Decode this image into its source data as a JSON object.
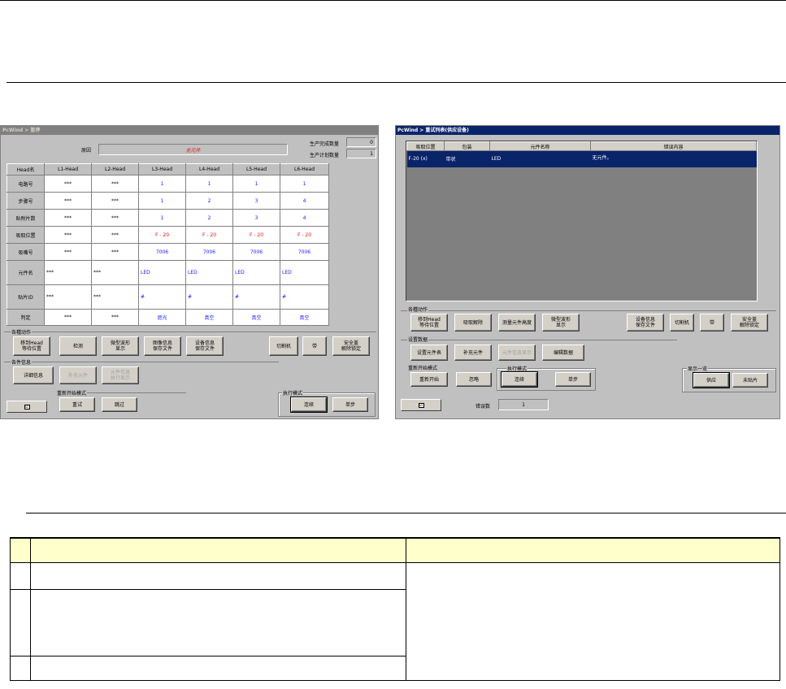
{
  "left_window": {
    "title": "PcWind > 暂停",
    "reason_label": "原因",
    "reason_value": "无元件",
    "production_done_label": "生产完成数量",
    "production_done_value": "0",
    "production_plan_label": "生产计划数量",
    "production_plan_value": "1",
    "grid_headers": [
      "Head名",
      "L1-Head",
      "L2-Head",
      "L3-Head",
      "L4-Head",
      "L5-Head",
      "L6-Head"
    ],
    "grid_rows": [
      {
        "label": "电路号",
        "cells": [
          "***",
          "***",
          "1",
          "1",
          "1",
          "1"
        ]
      },
      {
        "label": "步骤号",
        "cells": [
          "***",
          "***",
          "1",
          "2",
          "3",
          "4"
        ]
      },
      {
        "label": "贴附片数",
        "cells": [
          "***",
          "***",
          "1",
          "2",
          "3",
          "4"
        ]
      },
      {
        "label": "吸取位置",
        "cells": [
          "***",
          "***",
          "F - 20",
          "F - 20",
          "F - 20",
          "F - 20"
        ]
      },
      {
        "label": "吸嘴号",
        "cells": [
          "***",
          "***",
          "7006",
          "7006",
          "7006",
          "7006"
        ]
      },
      {
        "label": "元件名",
        "cells": [
          "***",
          "***",
          "LED",
          "LED",
          "LED",
          "LED"
        ]
      },
      {
        "label": "贴片ID",
        "cells": [
          "***",
          "***",
          "#",
          "#",
          "#",
          "#"
        ]
      },
      {
        "label": "判定",
        "cells": [
          "***",
          "***",
          "遮光",
          "真空",
          "真空",
          "真空"
        ]
      }
    ],
    "group_actions_label": "各種动作",
    "group_parts_label": "各件信息",
    "restart_mode_label": "重新开始模式",
    "exec_mode_label": "执行模式",
    "btn_move_head": "移到Head\n等待位置",
    "btn_detect": "检测",
    "btn_waveform": "微型波形\n显示",
    "btn_save_image": "图像信息\n保存文件",
    "btn_save_device": "设备信息\n保存文件",
    "btn_cutter": "切割机",
    "btn_tape": "带",
    "btn_safety": "安全盖\n解除锁定",
    "btn_detail": "详细信息",
    "btn_supply": "补充元件",
    "btn_parts_manage": "元件信息\n执行显示",
    "btn_retry": "重试",
    "btn_skip": "跳过",
    "btn_continuous": "连续",
    "btn_single": "单步",
    "checkbox_glyph": "☑"
  },
  "right_window": {
    "title": "PcWind > 重试列表(供应设备)",
    "list_headers": [
      "吸取位置",
      "包装",
      "元件名称",
      "错误内容"
    ],
    "list_rows": [
      {
        "position": "F-20 (x)",
        "package": "带状",
        "part_name": "LED",
        "error": "无元件。"
      }
    ],
    "group_actions_label": "各種动作",
    "group_setup_label": "设置数据",
    "restart_mode_label": "重新开始模式",
    "exec_mode_label": "执行模式",
    "display_list_label": "显示一览",
    "btn_move_head": "移到Head\n等待位置",
    "btn_suction_release": "吸取解除",
    "btn_measure_height": "测量元件高度",
    "btn_waveform": "微型波形\n显示",
    "btn_save_device": "设备信息\n保存文件",
    "btn_cutter": "切割机",
    "btn_tape": "带",
    "btn_safety": "安全盖\n解除锁定",
    "btn_set_parts": "设置元件表",
    "btn_supply": "补充元件",
    "btn_disabled_mid": "元件信息显示",
    "btn_edit_data": "编辑数据",
    "btn_restart": "重新开始",
    "btn_ignore": "忽略",
    "btn_continuous": "连续",
    "btn_single": "单步",
    "btn_supply_device": "供应",
    "btn_unplaced": "未贴片",
    "error_count_label": "错误数",
    "error_count_value": "1",
    "checkbox_glyph": "☑"
  }
}
